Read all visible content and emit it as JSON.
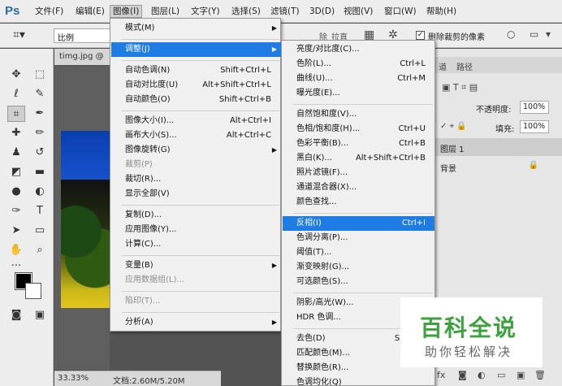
{
  "app": {
    "logo": "Ps",
    "menubar": [
      "文件(F)",
      "编辑(E)",
      "图像(I)",
      "图层(L)",
      "文字(Y)",
      "选择(S)",
      "滤镜(T)",
      "3D(D)",
      "视图(V)",
      "窗口(W)",
      "帮助(H)"
    ],
    "active_menu": "图像(I)"
  },
  "options_bar": {
    "ratio": "比例",
    "ghost_labels": [
      "除",
      "拉直"
    ],
    "delete_cropped_label": "删除裁剪的像素",
    "delete_cropped_checked": "✓"
  },
  "document": {
    "tab": "timg.jpg @",
    "zoom": "33.33%",
    "doc_info": "文档:2.60M/5.20M"
  },
  "image_menu": [
    {
      "label": "模式(M)",
      "submenu": true
    },
    {
      "sep": true
    },
    {
      "label": "调整(J)",
      "submenu": true,
      "highlight": true
    },
    {
      "sep": true
    },
    {
      "label": "自动色调(N)",
      "shortcut": "Shift+Ctrl+L"
    },
    {
      "label": "自动对比度(U)",
      "shortcut": "Alt+Shift+Ctrl+L"
    },
    {
      "label": "自动颜色(O)",
      "shortcut": "Shift+Ctrl+B"
    },
    {
      "sep": true
    },
    {
      "label": "图像大小(I)...",
      "shortcut": "Alt+Ctrl+I"
    },
    {
      "label": "画布大小(S)...",
      "shortcut": "Alt+Ctrl+C"
    },
    {
      "label": "图像旋转(G)",
      "submenu": true
    },
    {
      "label": "裁剪(P)",
      "disabled": true
    },
    {
      "label": "裁切(R)..."
    },
    {
      "label": "显示全部(V)"
    },
    {
      "sep": true
    },
    {
      "label": "复制(D)..."
    },
    {
      "label": "应用图像(Y)..."
    },
    {
      "label": "计算(C)..."
    },
    {
      "sep": true
    },
    {
      "label": "变量(B)",
      "submenu": true
    },
    {
      "label": "应用数据组(L)...",
      "disabled": true
    },
    {
      "sep": true
    },
    {
      "label": "陷印(T)...",
      "disabled": true
    },
    {
      "sep": true
    },
    {
      "label": "分析(A)",
      "submenu": true
    }
  ],
  "adjust_menu": [
    {
      "label": "亮度/对比度(C)..."
    },
    {
      "label": "色阶(L)...",
      "shortcut": "Ctrl+L"
    },
    {
      "label": "曲线(U)...",
      "shortcut": "Ctrl+M"
    },
    {
      "label": "曝光度(E)..."
    },
    {
      "sep": true
    },
    {
      "label": "自然饱和度(V)..."
    },
    {
      "label": "色相/饱和度(H)...",
      "shortcut": "Ctrl+U"
    },
    {
      "label": "色彩平衡(B)...",
      "shortcut": "Ctrl+B"
    },
    {
      "label": "黑白(K)...",
      "shortcut": "Alt+Shift+Ctrl+B"
    },
    {
      "label": "照片滤镜(F)..."
    },
    {
      "label": "通道混合器(X)..."
    },
    {
      "label": "颜色查找..."
    },
    {
      "sep": true
    },
    {
      "label": "反相(I)",
      "shortcut": "Ctrl+I",
      "highlight": true
    },
    {
      "label": "色调分离(P)..."
    },
    {
      "label": "阈值(T)..."
    },
    {
      "label": "渐变映射(G)..."
    },
    {
      "label": "可选颜色(S)..."
    },
    {
      "sep": true
    },
    {
      "label": "阴影/高光(W)..."
    },
    {
      "label": "HDR 色调..."
    },
    {
      "sep": true
    },
    {
      "label": "去色(D)",
      "shortcut": "Shift+C"
    },
    {
      "label": "匹配颜色(M)..."
    },
    {
      "label": "替换颜色(R)..."
    },
    {
      "label": "色调均化(Q)"
    }
  ],
  "right_panel": {
    "tabs": [
      "道",
      "路径"
    ],
    "opacity_label": "不透明度:",
    "opacity_value": "100%",
    "fill_label": "填充:",
    "fill_value": "100%",
    "layers": [
      "图层 1",
      "背景"
    ]
  },
  "watermark": {
    "title": "百科全说",
    "subtitle": "助你轻松解决",
    "color": "#3ea03e"
  }
}
